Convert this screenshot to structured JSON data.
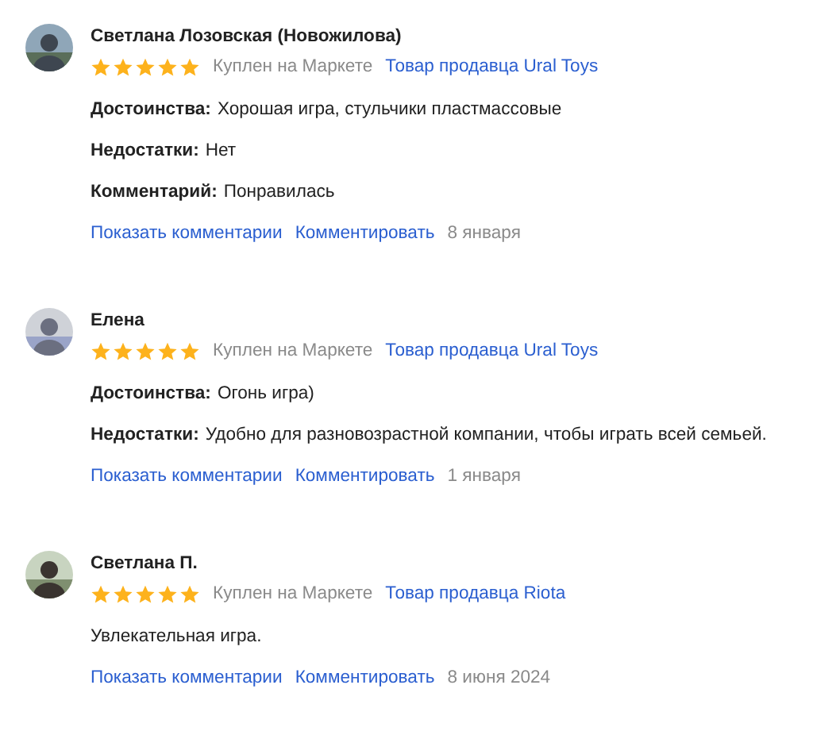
{
  "reviews": [
    {
      "author": "Светлана Лозовская (Новожилова)",
      "stars": 5,
      "purchase": "Куплен на Маркете",
      "seller": "Товар продавца Ural Toys",
      "body": [
        {
          "kind": "labeled",
          "label": "Достоинства:",
          "text": "Хорошая игра, стульчики пластмассовые"
        },
        {
          "kind": "labeled",
          "label": "Недостатки:",
          "text": "Нет"
        },
        {
          "kind": "labeled",
          "label": "Комментарий:",
          "text": "Понравилась"
        }
      ],
      "show_comments": "Показать комментарии",
      "comment": "Комментировать",
      "date": "8 января"
    },
    {
      "author": "Елена",
      "stars": 5,
      "purchase": "Куплен на Маркете",
      "seller": "Товар продавца Ural Toys",
      "body": [
        {
          "kind": "labeled",
          "label": "Достоинства:",
          "text": "Огонь игра)"
        },
        {
          "kind": "labeled",
          "label": "Недостатки:",
          "text": "Удобно для разновозрастной компании, чтобы играть всей семьей."
        }
      ],
      "show_comments": "Показать комментарии",
      "comment": "Комментировать",
      "date": "1 января"
    },
    {
      "author": "Светлана П.",
      "stars": 5,
      "purchase": "Куплен на Маркете",
      "seller": "Товар продавца Riota",
      "body": [
        {
          "kind": "plain",
          "text": "Увлекательная игра."
        }
      ],
      "show_comments": "Показать комментарии",
      "comment": "Комментировать",
      "date": "8 июня 2024"
    }
  ]
}
